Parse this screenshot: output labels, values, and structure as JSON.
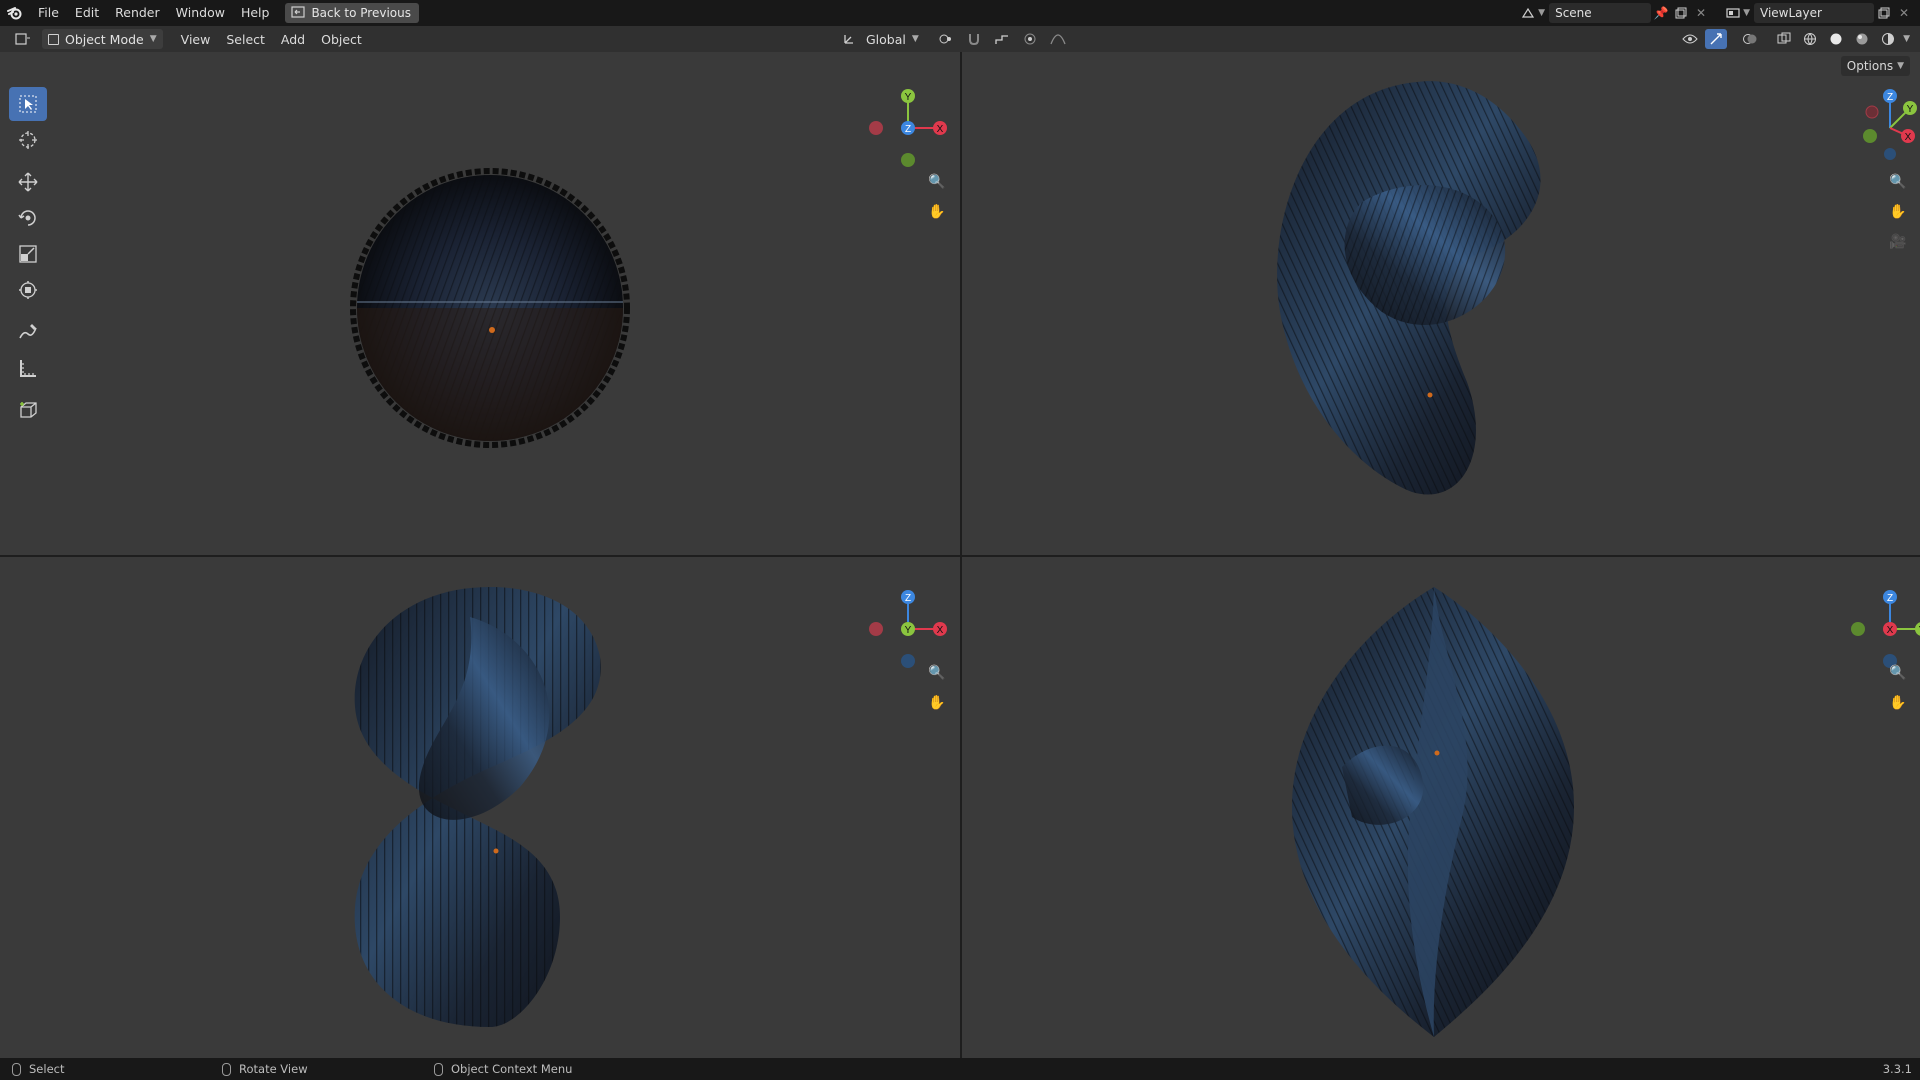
{
  "topbar": {
    "menus": [
      "File",
      "Edit",
      "Render",
      "Window",
      "Help"
    ],
    "back_button": "Back to Previous",
    "scene": "Scene",
    "view_layer": "ViewLayer"
  },
  "header": {
    "mode": "Object Mode",
    "menus": [
      "View",
      "Select",
      "Add",
      "Object"
    ],
    "transform_orientation": "Global",
    "options": "Options"
  },
  "gizmos": {
    "top": {
      "up": "Y",
      "center": "Z",
      "right": "X"
    },
    "front": {
      "up": "Z",
      "center": "Y",
      "right": "X"
    },
    "right": {
      "up": "Z",
      "center": "X",
      "right": "Y"
    },
    "user": {
      "up": "Z",
      "right_top": "Y",
      "right": "X"
    }
  },
  "icons": {
    "logo": "blender-logo-icon",
    "zoom": "zoom-icon",
    "pan": "hand-icon",
    "camera": "camera-icon"
  },
  "colors": {
    "accent": "#4772b3",
    "axis_x": "#e0394d",
    "axis_y": "#8bc53f",
    "axis_z": "#3c87e0",
    "viewport_bg": "#3a3a3a"
  },
  "statusbar": {
    "left": "Select",
    "middle": "Rotate View",
    "right": "Object Context Menu",
    "version": "3.3.1"
  }
}
